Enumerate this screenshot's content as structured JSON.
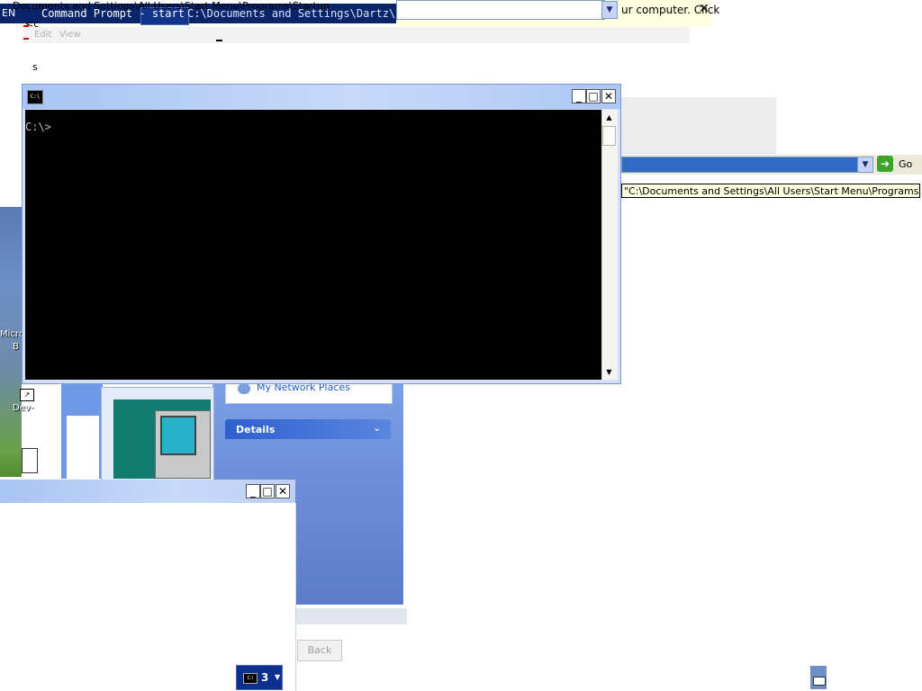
{
  "top": {
    "path_title": "Documents and Settings\\All Users\\Start Menu\\Programs\\Startup",
    "language": "EN",
    "prompt_title_fragment": "Command Prompt - start",
    "group_count": "3",
    "window_path": "C:\\Documents and Settings\\Dartz\\Rece",
    "menu": [
      "Edit",
      "View"
    ],
    "stray_chars": [
      "<c",
      "s"
    ]
  },
  "notice": {
    "text": "ur computer. Click",
    "close": "✕"
  },
  "desktop": {
    "labels": [
      "Micro",
      "B",
      "Dev-"
    ]
  },
  "cmd": {
    "icon_text": "C:\\",
    "prompt": "C:\\>",
    "buttons": {
      "minimize": "_",
      "maximize": "□",
      "close": "✕"
    }
  },
  "address": {
    "go_label": "Go",
    "tooltip": "\"C:\\Documents and Settings\\All Users\\Start Menu\\Programs\\Startup\""
  },
  "explorer": {
    "network_places": "My Network Places",
    "details": "Details",
    "back": "Back"
  },
  "window2": {
    "buttons": {
      "minimize": "_",
      "maximize": "□",
      "close": "✕"
    }
  },
  "taskbar": {
    "group_icon_text": "C:\\",
    "group_count": "3"
  }
}
